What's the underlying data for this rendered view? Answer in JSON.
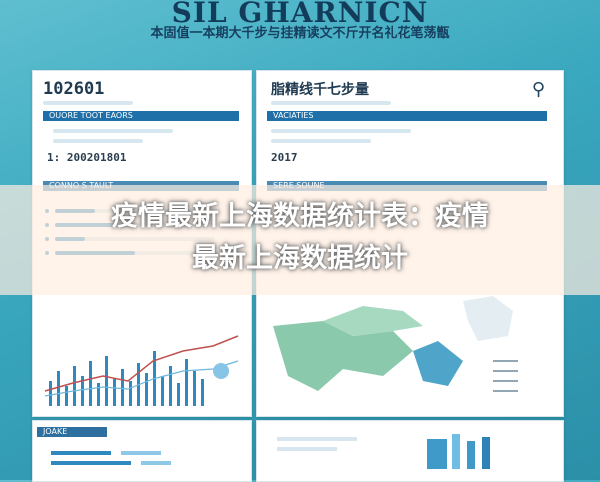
{
  "banner": {
    "title": "SIL GHARNICN",
    "subtitle": "本固值一本期大千步与挂精读文不斤开名礼花笔荡甑"
  },
  "left_panel": {
    "code_title": "102601",
    "section_label_1": "OUORE TOOT EAORS",
    "date_value": "1: 200201801",
    "section_label_2": "CONNO S TAULT",
    "bottom_label": "JOAKE"
  },
  "right_panel": {
    "head_title": "脂精线千七步量",
    "section_label_1": "VACIATIES",
    "date_value": "2017",
    "section_label_2": "SERE SOUNE"
  },
  "overlay": {
    "title_line1": "疫情最新上海数据统计表：疫情",
    "title_line2": "最新上海数据统计"
  }
}
